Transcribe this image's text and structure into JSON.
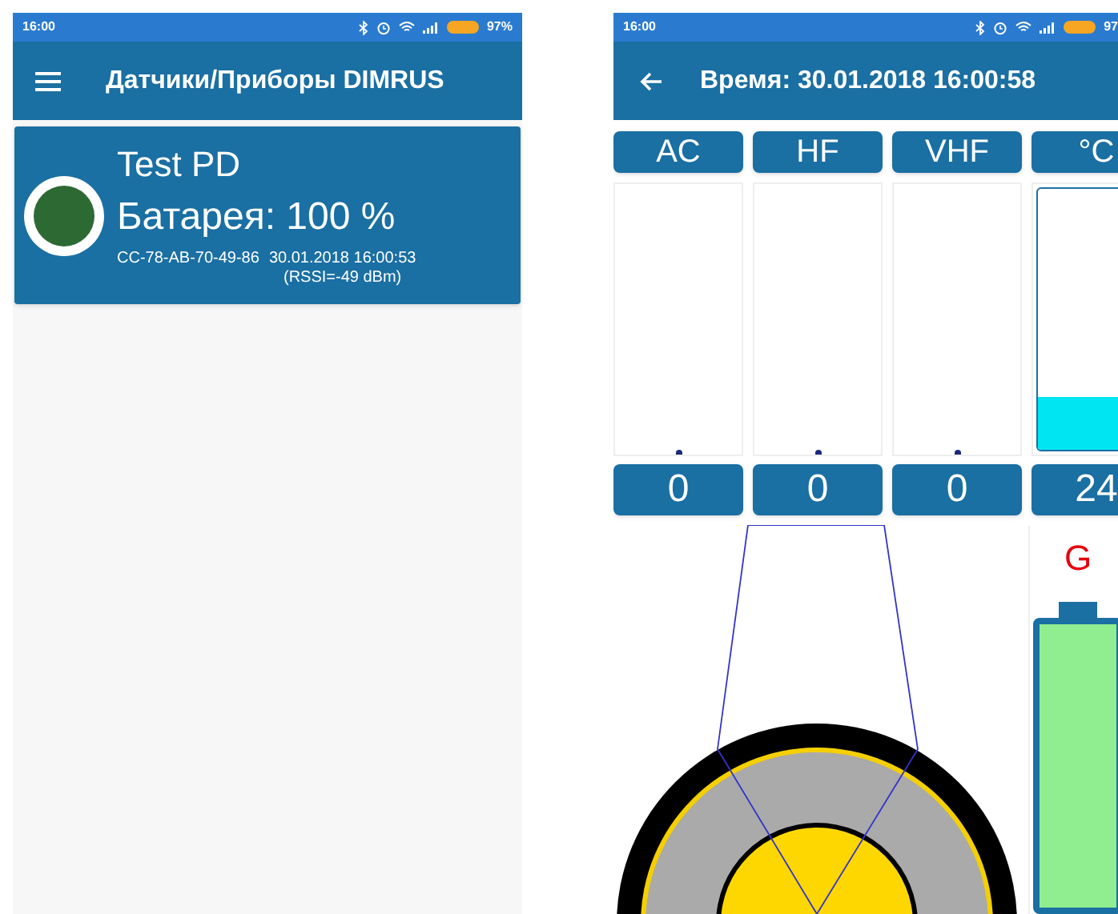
{
  "left_screen": {
    "status_bar": {
      "time": "16:00",
      "battery": "97%"
    },
    "app_bar": {
      "title": "Датчики/Приборы DIMRUS"
    },
    "devices": [
      {
        "name": "Test PD",
        "battery": "Батарея: 100 %",
        "mac": "CC-78-AB-70-49-86",
        "time": "30.01.2018 16:00:53",
        "rssi": "(RSSI=-49 dBm)",
        "color": "#2d6a33"
      }
    ]
  },
  "right_screen": {
    "status_bar": {
      "time": "16:00",
      "battery": "97"
    },
    "app_bar": {
      "title": "Время: 30.01.2018 16:00:58"
    },
    "channels": [
      {
        "kind": "signal",
        "label": "AC",
        "value": "0",
        "level": 0
      },
      {
        "kind": "signal",
        "label": "HF",
        "value": "0",
        "level": 0
      },
      {
        "kind": "signal",
        "label": "VHF",
        "value": "0",
        "level": 0
      },
      {
        "kind": "temperature",
        "label": "°C",
        "value": "24",
        "level": 0.2
      }
    ],
    "battery_gauge": {
      "label": "G",
      "level": 1
    }
  }
}
